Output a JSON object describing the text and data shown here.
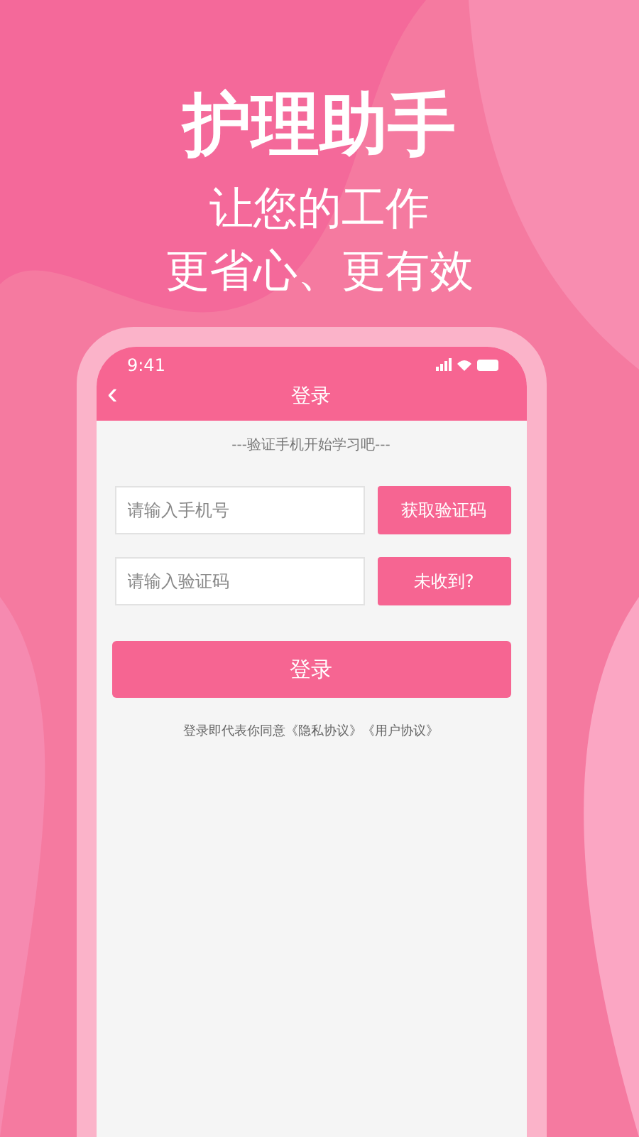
{
  "headline": "护理助手",
  "tagline": [
    "让您的工作",
    "更省心、更有效"
  ],
  "status_bar": {
    "time": "9:41"
  },
  "nav": {
    "back": "‹",
    "title": "登录"
  },
  "hint": "---验证手机开始学习吧---",
  "fields": [
    {
      "placeholder": "请输入手机号",
      "button": "获取验证码"
    },
    {
      "placeholder": "请输入验证码",
      "button": "未收到?"
    }
  ],
  "login_button": "登录",
  "agreement": {
    "text": "登录即代表你同意",
    "links": [
      "《隐私协议》",
      "《用户协议》"
    ]
  }
}
